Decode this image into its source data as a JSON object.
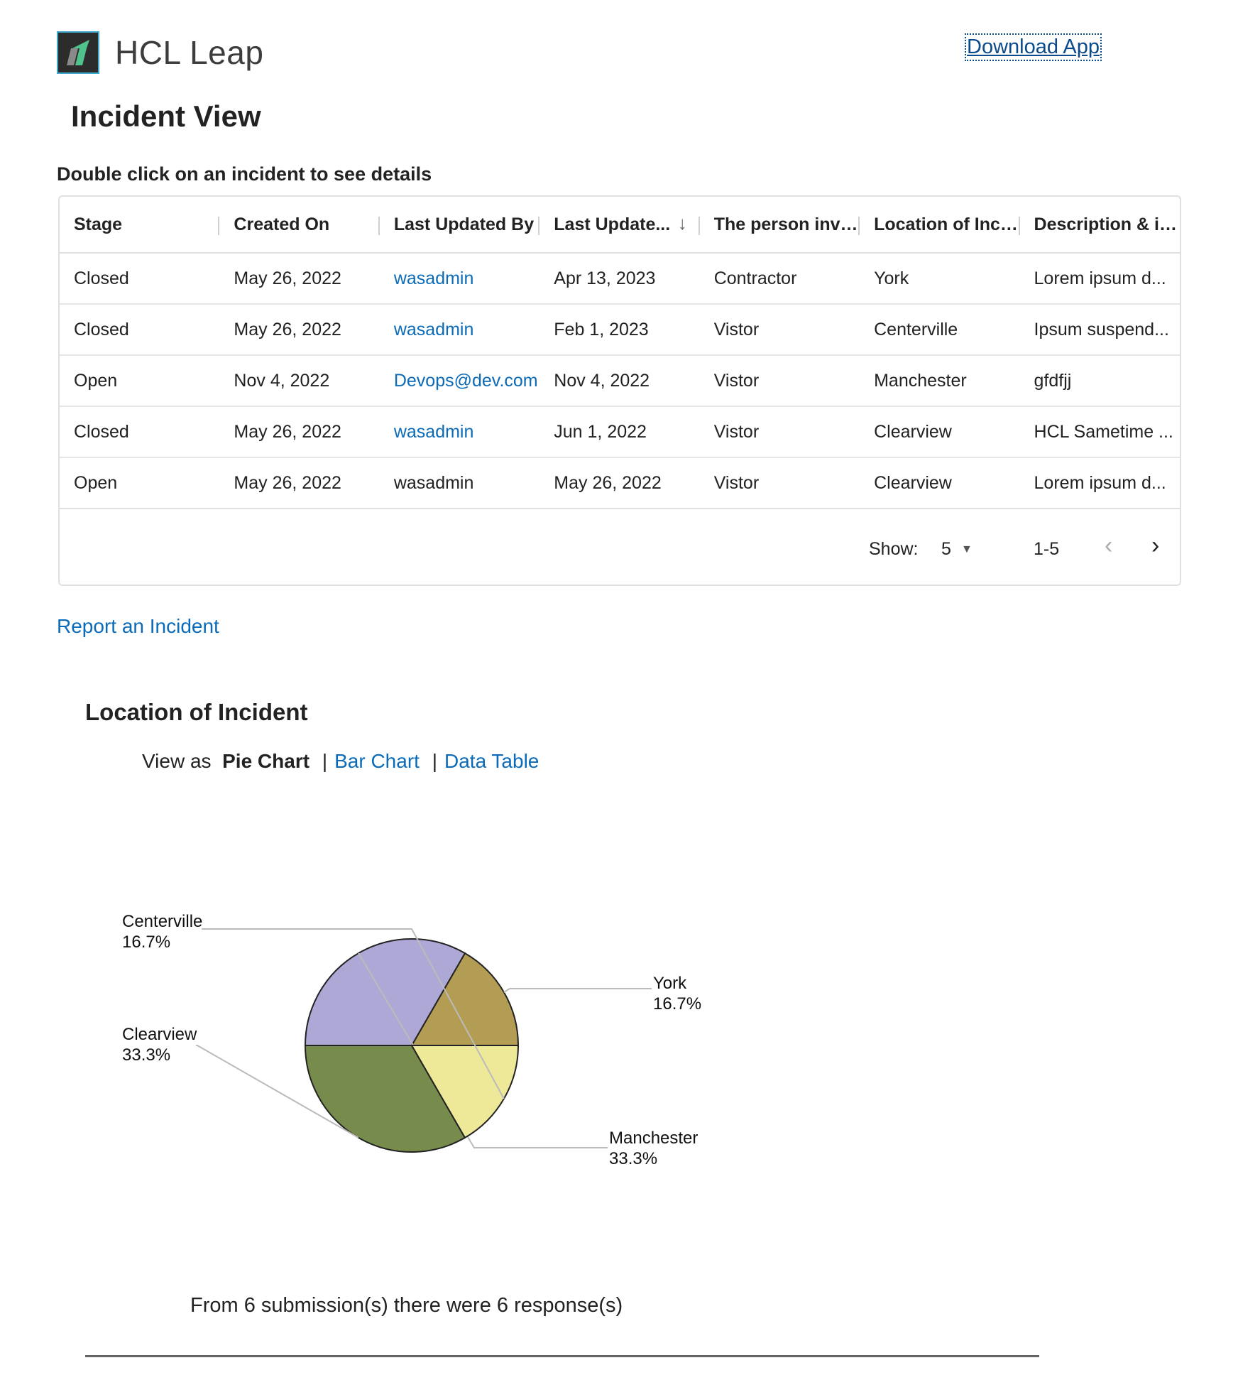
{
  "header": {
    "app_name": "HCL Leap",
    "download_label": "Download App"
  },
  "page": {
    "title": "Incident View",
    "hint": "Double click on an incident to see details"
  },
  "grid": {
    "columns": [
      "Stage",
      "Created On",
      "Last Updated By",
      "Last Update...",
      "The person invol...",
      "Location of Incid...",
      "Description & im..."
    ],
    "rows": [
      [
        "Closed",
        "May 26, 2022",
        "wasadmin",
        "Apr 13, 2023",
        "Contractor",
        "York",
        "Lorem ipsum d..."
      ],
      [
        "Closed",
        "May 26, 2022",
        "wasadmin",
        "Feb 1, 2023",
        "Vistor",
        "Centerville",
        "Ipsum suspend..."
      ],
      [
        "Open",
        "Nov 4, 2022",
        "Devops@dev.com",
        "Nov 4, 2022",
        "Vistor",
        "Manchester",
        "gfdfjj"
      ],
      [
        "Closed",
        "May 26, 2022",
        "wasadmin",
        "Jun 1, 2022",
        "Vistor",
        "Clearview",
        "HCL Sametime ..."
      ],
      [
        "Open",
        "May 26, 2022",
        "wasadmin",
        "May 26, 2022",
        "Vistor",
        "Clearview",
        "Lorem ipsum d..."
      ]
    ],
    "footer": {
      "show_label": "Show:",
      "page_size": "5",
      "range": "1-5"
    }
  },
  "report_link": "Report an Incident",
  "report_section": {
    "title": "Location of Incident",
    "view_as_label": "View as",
    "current_view": "Pie Chart",
    "other_views": [
      "Bar Chart",
      "Data Table"
    ],
    "summary": "From 6 submission(s) there were 6 response(s)"
  },
  "chart_data": {
    "type": "pie",
    "categories": [
      "York",
      "Manchester",
      "Clearview",
      "Centerville"
    ],
    "values": [
      1,
      2,
      2,
      1
    ],
    "percent_labels": [
      "16.7%",
      "33.3%",
      "33.3%",
      "16.7%"
    ],
    "colors": [
      "#b39d54",
      "#aea8d6",
      "#778b4c",
      "#eee899"
    ]
  }
}
